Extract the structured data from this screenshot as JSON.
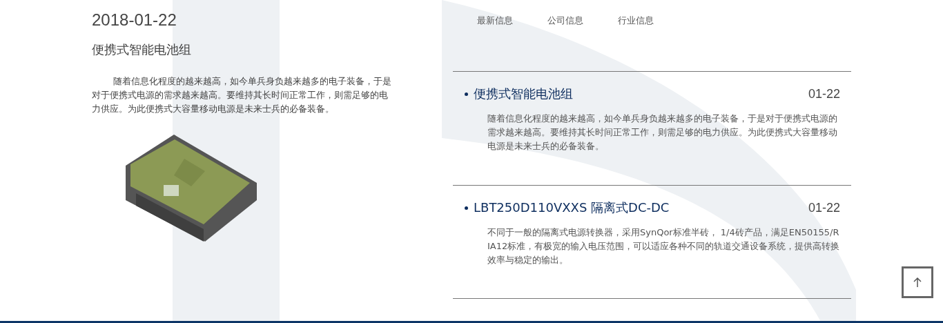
{
  "feature": {
    "date": "2018-01-22",
    "title": "便携式智能电池组",
    "summary": "随着信息化程度的越来越高，如今单兵身负越来越多的电子装备，于是对于便携式电源的需求越来越高。要维持其长时间正常工作，则需足够的电力供应。为此便携式大容量移动电源是未来士兵的必备装备。"
  },
  "tabs": [
    {
      "label": "最新信息"
    },
    {
      "label": "公司信息"
    },
    {
      "label": "行业信息"
    }
  ],
  "news": [
    {
      "title": "便携式智能电池组",
      "date": "01-22",
      "summary": "随着信息化程度的越来越高，如今单兵身负越来越多的电子装备，于是对于便携式电源的需求越来越高。要维持其长时间正常工作，则需足够的电力供应。为此便携式大容量移动电源是未来士兵的必备装备。"
    },
    {
      "title": "LBT250D110VXXS 隔离式DC-DC",
      "date": "01-22",
      "summary": "不同于一般的隔离式电源转换器，采用SynQor标准半砖， 1/4砖产品，满足EN50155/RIA12标准，有极宽的输入电压范围，可以适应各种不同的轨道交通设备系统，提供高转换效率与稳定的输出。"
    }
  ]
}
